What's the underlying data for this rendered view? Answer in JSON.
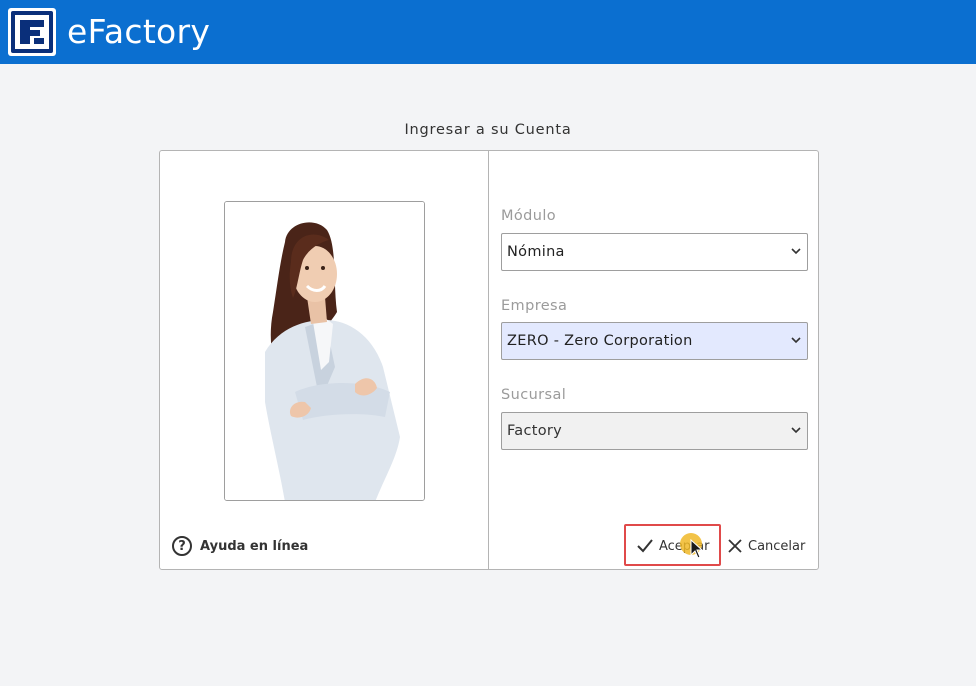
{
  "header": {
    "app_title": "eFactory",
    "logo_icon": "efactory-logo-icon",
    "bar_color": "#0b6fd0"
  },
  "login": {
    "title": "Ingresar a su Cuenta",
    "help_label": "Ayuda en línea",
    "fields": {
      "modulo": {
        "label": "Módulo",
        "value": "Nómina"
      },
      "empresa": {
        "label": "Empresa",
        "value": "ZERO - Zero Corporation"
      },
      "sucursal": {
        "label": "Sucursal",
        "value": "Factory"
      }
    },
    "buttons": {
      "accept_label": "Aceptar",
      "cancel_label": "Cancelar"
    },
    "highlight_color": "#e04a4a"
  }
}
